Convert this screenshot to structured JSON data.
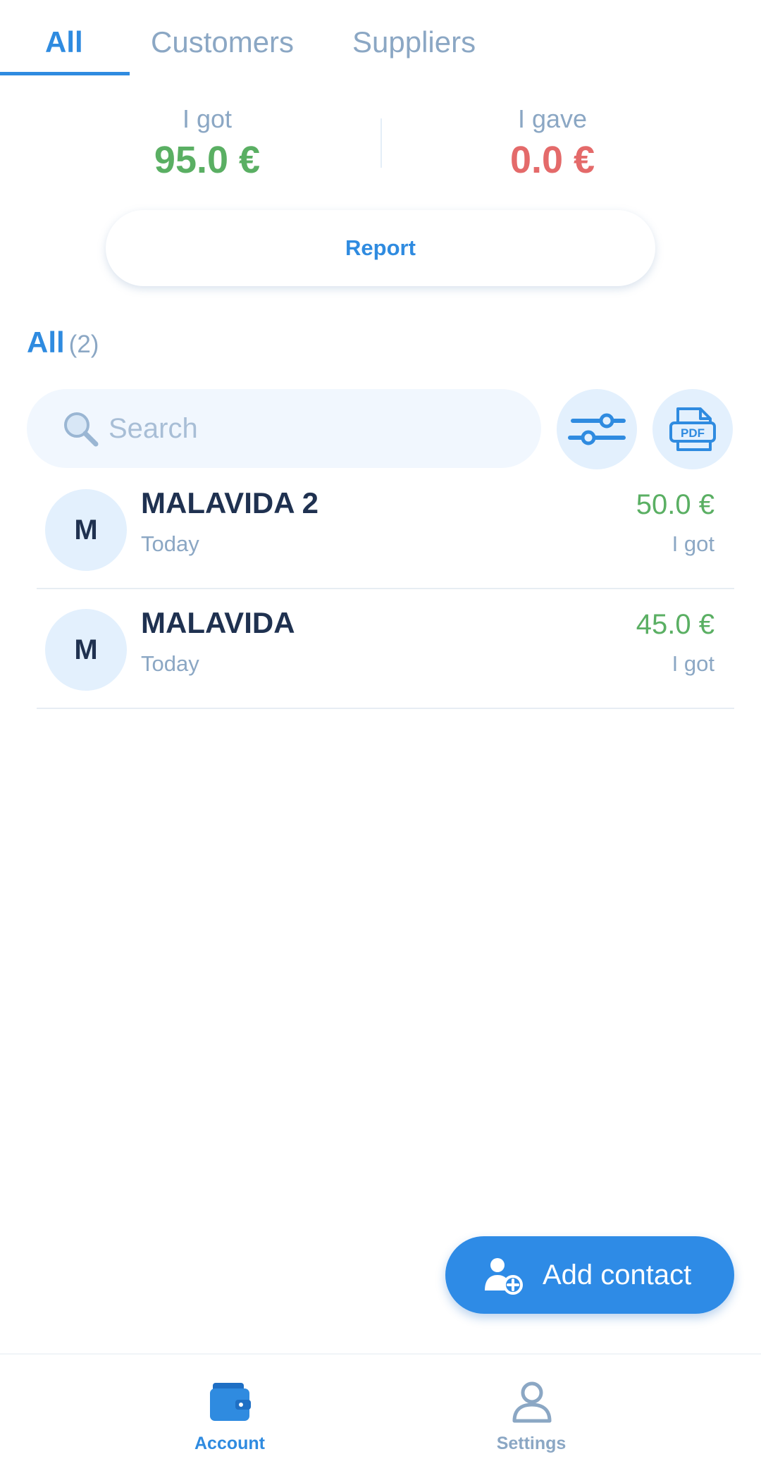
{
  "tabs": [
    {
      "label": "All",
      "active": true
    },
    {
      "label": "Customers",
      "active": false
    },
    {
      "label": "Suppliers",
      "active": false
    }
  ],
  "summary": {
    "got_label": "I got",
    "got_value": "95.0 €",
    "gave_label": "I gave",
    "gave_value": "0.0 €"
  },
  "report_button": "Report",
  "section": {
    "title": "All",
    "count": "(2)"
  },
  "search": {
    "placeholder": "Search",
    "icon": "search-icon"
  },
  "actions": {
    "filter_icon": "sliders-icon",
    "pdf_icon": "pdf-icon",
    "pdf_text": "PDF"
  },
  "contacts": [
    {
      "initial": "M",
      "name": "MALAVIDA 2",
      "date": "Today",
      "amount": "50.0 €",
      "type": "I got"
    },
    {
      "initial": "M",
      "name": "MALAVIDA",
      "date": "Today",
      "amount": "45.0 €",
      "type": "I got"
    }
  ],
  "fab": {
    "label": "Add contact",
    "icon": "add-user-icon"
  },
  "bottom_nav": [
    {
      "label": "Account",
      "icon": "wallet-icon",
      "active": true
    },
    {
      "label": "Settings",
      "icon": "user-icon",
      "active": false
    }
  ],
  "colors": {
    "accent": "#2f8be0",
    "positive": "#5aaf63",
    "negative": "#e46a6a",
    "muted": "#8ba7c4",
    "text": "#1f3150"
  }
}
